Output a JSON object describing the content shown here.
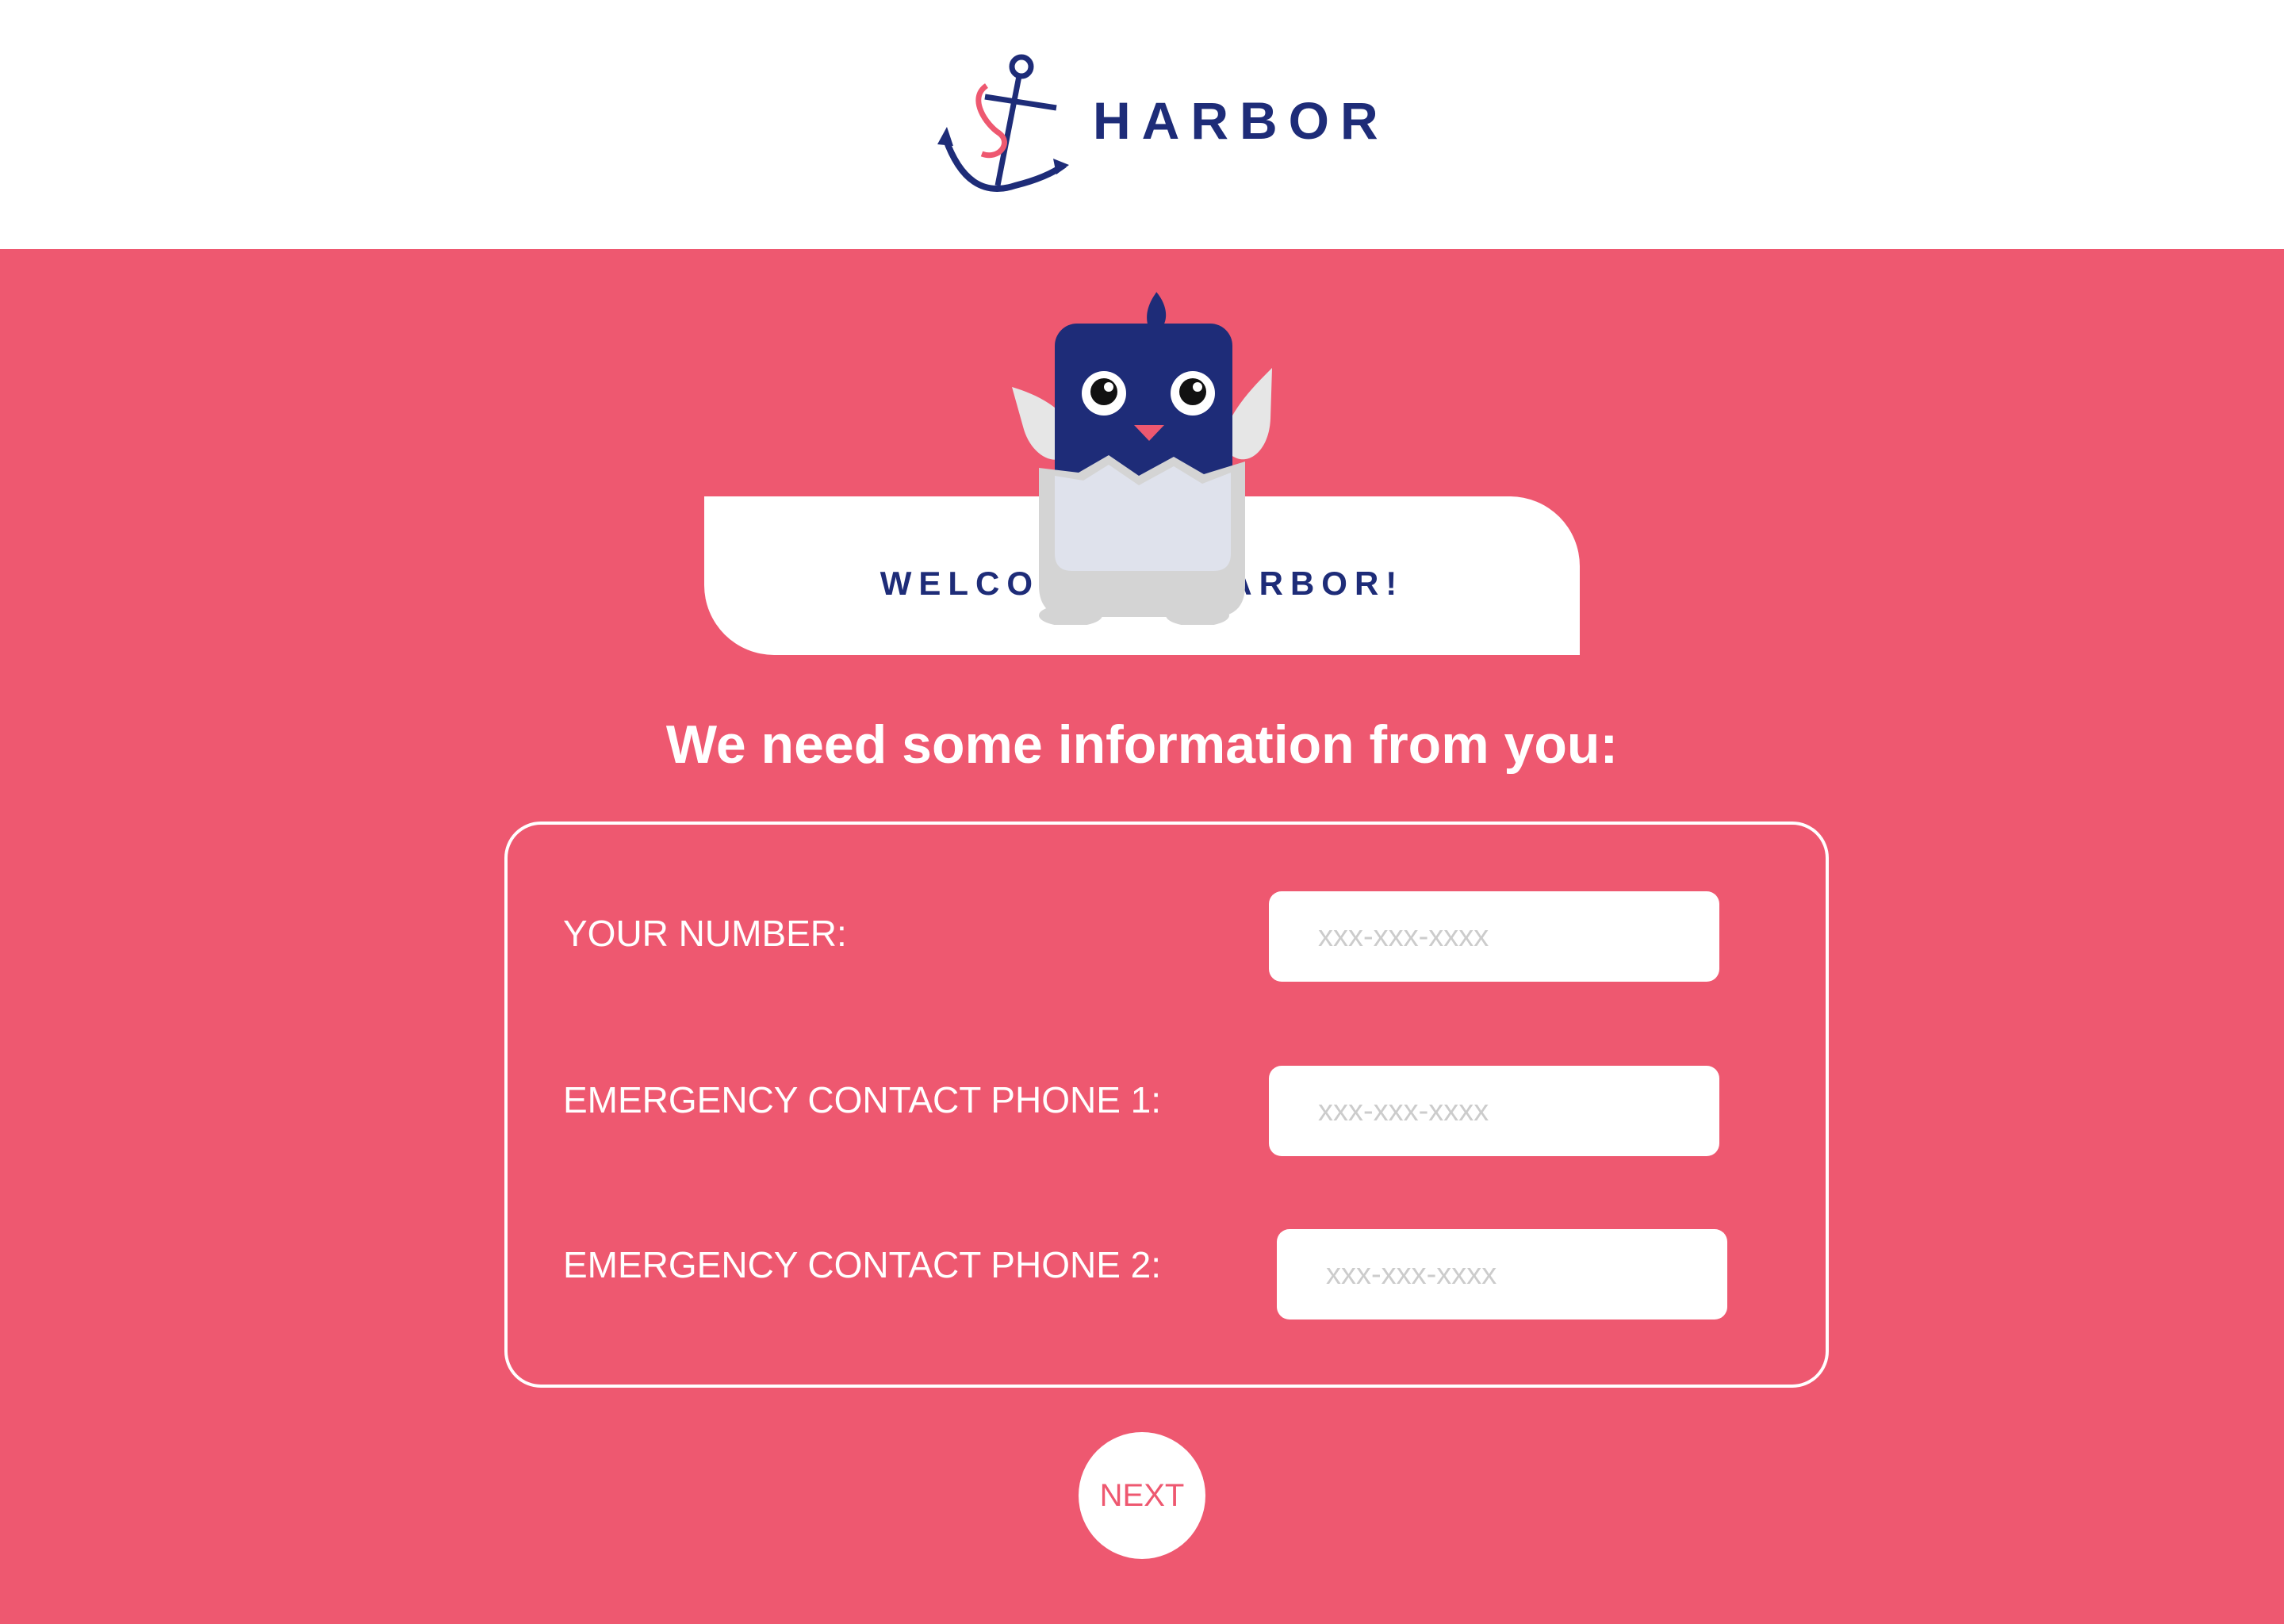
{
  "brand": {
    "name": "HARBOR",
    "logo_icon": "anchor-icon"
  },
  "welcome": {
    "text": "WELCOME TO HARBOR!",
    "mascot_icon": "bird-in-egg-icon"
  },
  "heading": "We need some information from you:",
  "form": {
    "fields": [
      {
        "label": "YOUR NUMBER:",
        "placeholder": "xxx-xxx-xxxx",
        "value": ""
      },
      {
        "label": "EMERGENCY CONTACT PHONE 1:",
        "placeholder": "xxx-xxx-xxxx",
        "value": ""
      },
      {
        "label": "EMERGENCY CONTACT PHONE 2:",
        "placeholder": "xxx-xxx-xxxx",
        "value": ""
      }
    ]
  },
  "next_button": {
    "label": "NEXT"
  },
  "colors": {
    "background": "#ee5870",
    "navy": "#1e2c78",
    "white": "#ffffff",
    "placeholder": "#cccccc"
  }
}
